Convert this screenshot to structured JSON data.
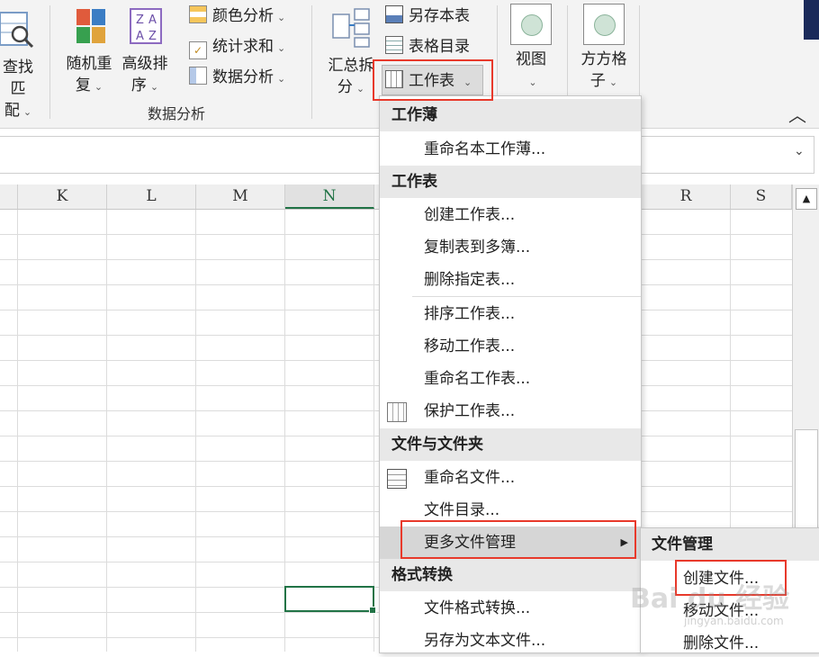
{
  "ribbon": {
    "find_match": {
      "line1": "查找匹",
      "line2": "配"
    },
    "random_repeat": {
      "line1": "随机重",
      "line2": "复"
    },
    "advanced_sort": {
      "line1": "高级排",
      "line2": "序"
    },
    "color_analysis": "颜色分析",
    "stat_sum": "统计求和",
    "data_analysis_btn": "数据分析",
    "group_data_analysis": "数据分析",
    "summary_split": {
      "line1": "汇总拆",
      "line2": "分"
    },
    "save_table": "另存本表",
    "table_directory": "表格目录",
    "worksheet": "工作表",
    "view": "视图",
    "square_grid": {
      "line1": "方方格",
      "line2": "子"
    }
  },
  "columns": [
    "K",
    "L",
    "M",
    "N",
    "R",
    "S"
  ],
  "menu": {
    "workbook_header": "工作薄",
    "rename_workbook": "重命名本工作薄...",
    "worksheet_header": "工作表",
    "create_worksheet": "创建工作表...",
    "copy_to_multi": "复制表到多簿...",
    "delete_sheet": "删除指定表...",
    "sort_sheets": "排序工作表...",
    "move_sheet": "移动工作表...",
    "rename_sheet": "重命名工作表...",
    "protect_sheet": "保护工作表...",
    "file_header": "文件与文件夹",
    "rename_file": "重命名文件...",
    "file_directory": "文件目录...",
    "more_file_mgmt": "更多文件管理",
    "format_header": "格式转换",
    "file_format_convert": "文件格式转换...",
    "save_as_text": "另存为文本文件..."
  },
  "submenu": {
    "header": "文件管理",
    "create_file": "创建文件...",
    "move_file": "移动文件...",
    "delete_file": "删除文件..."
  },
  "watermark": {
    "text": "Bai du 经验",
    "url": "jingyan.baidu.com"
  },
  "colors": {
    "accent": "#217346",
    "highlight_box": "#e8392b"
  }
}
